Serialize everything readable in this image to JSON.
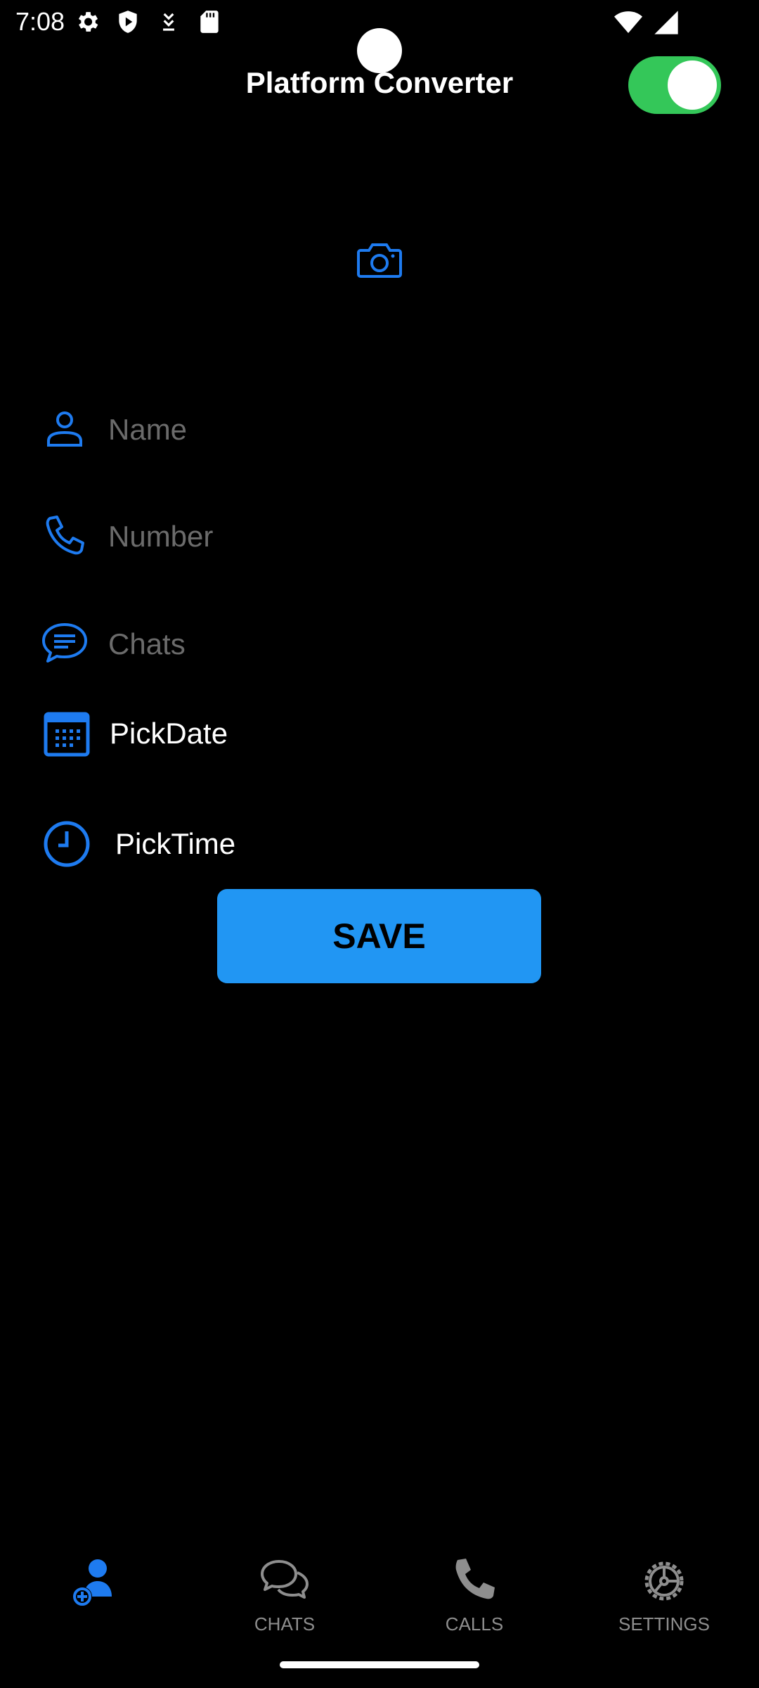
{
  "status_bar": {
    "time": "7:08",
    "left_icons": [
      "settings-icon",
      "shield-play-icon",
      "download-icon",
      "sd-card-icon"
    ],
    "right_icons": [
      "wifi-icon",
      "signal-icon"
    ]
  },
  "header": {
    "title": "Platform Converter",
    "toggle_on": true,
    "toggle_color": "#34c759"
  },
  "form": {
    "avatar_icon": "camera-icon",
    "name_placeholder": "Name",
    "name_value": "",
    "number_placeholder": "Number",
    "number_value": "",
    "chats_placeholder": "Chats",
    "chats_value": "",
    "pick_date_label": "PickDate",
    "pick_time_label": "PickTime",
    "save_label": "SAVE"
  },
  "bottom_nav": {
    "items": [
      {
        "label": "",
        "icon": "add-contact-icon",
        "active": true
      },
      {
        "label": "CHATS",
        "icon": "chats-icon",
        "active": false
      },
      {
        "label": "CALLS",
        "icon": "phone-icon",
        "active": false
      },
      {
        "label": "SETTINGS",
        "icon": "settings-icon",
        "active": false
      }
    ]
  },
  "colors": {
    "accent": "#1e7bf0",
    "button": "#2196f3",
    "background": "#000000",
    "inactive": "#8e8e8e",
    "placeholder": "#6b6b6b"
  }
}
